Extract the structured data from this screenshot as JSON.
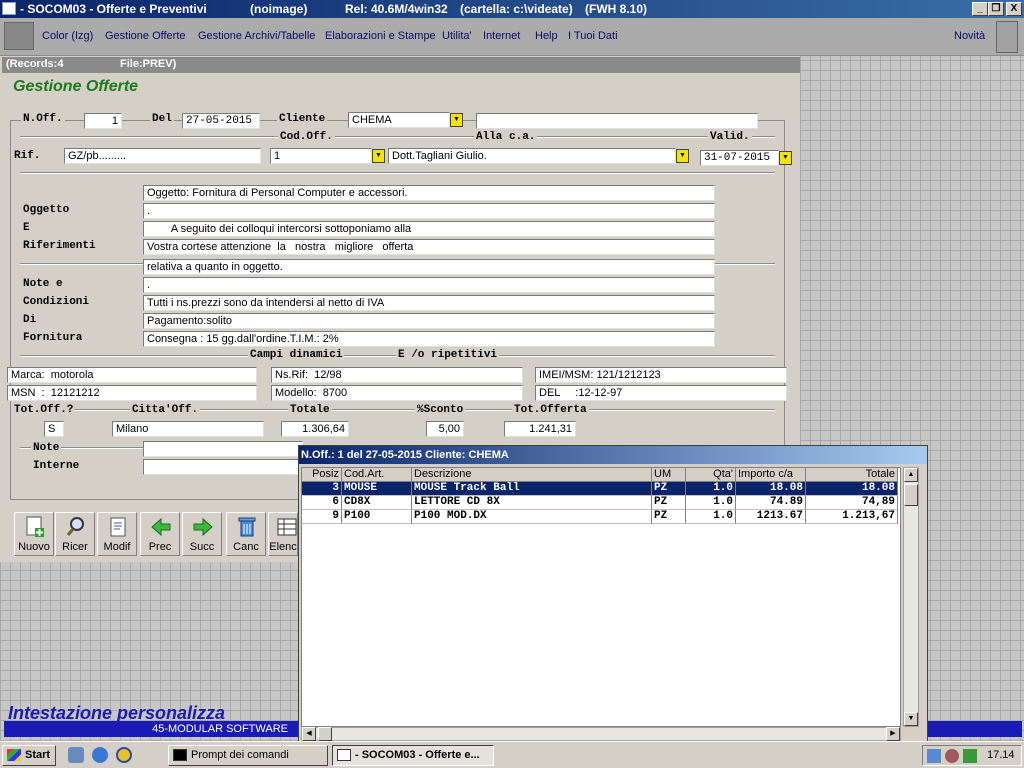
{
  "window": {
    "title": "- SOCOM03 - Offerte e Preventivi",
    "info1": "(noimage)",
    "info2": "Rel: 40.6M/4win32",
    "info3": "(cartella: c:\\videate)",
    "info4": "(FWH 8.10)",
    "btn_min": "_",
    "btn_restore": "❐",
    "btn_close": "X"
  },
  "menu": {
    "items": [
      "Color (Izg)",
      "Gestione Offerte",
      "Gestione Archivi/Tabelle",
      "Elaborazioni e Stampe",
      "Utilita'",
      "Internet",
      "Help",
      "I Tuoi Dati"
    ],
    "novita": "Novità"
  },
  "status": {
    "records": "(Records:4",
    "file": "File:PREV)"
  },
  "form": {
    "title": "Gestione Offerte",
    "labels": {
      "noff": "N.Off.",
      "del": "Del",
      "cliente": "Cliente",
      "codoff": "Cod.Off.",
      "alla": "Alla c.a.",
      "valid": "Valid.",
      "rif": "Rif.",
      "oggetto": "Oggetto",
      "e": "E",
      "riferimenti": "Riferimenti",
      "note_e": "Note e",
      "condizioni": "Condizioni",
      "di": "Di",
      "fornitura": "Fornitura",
      "campi": "Campi dinamici",
      "ripetitivi": "E /o ripetitivi",
      "totoff": "Tot.Off.?",
      "citta": "Citta'Off.",
      "totale": "Totale",
      "sconto": "%Sconto",
      "totofferta": "Tot.Offerta",
      "note": "Note",
      "interne": "Interne"
    },
    "values": {
      "noff": "1",
      "del": "27-05-2015",
      "cliente": "CHEMA",
      "cliente_desc": "",
      "rif": "GZ/pb.........",
      "codoff": "1",
      "alla": "Dott.Tagliani Giulio.",
      "valid": "31-07-2015",
      "testo": [
        "Oggetto: Fornitura di Personal Computer e accessori.",
        ".",
        "        A seguito dei colloqui intercorsi sottoponiamo alla",
        "Vostra cortese attenzione  la   nostra   migliore   offerta",
        "relativa a quanto in oggetto."
      ],
      "condizioni": [
        ".",
        "Tutti i ns.prezzi sono da intendersi al netto di IVA",
        "Pagamento:solito",
        "Consegna : 15 gg.dall'ordine.T.I.M.: 2%"
      ],
      "dinamici": [
        "Marca:  motorola",
        "Ns.Rif:  12/98",
        "IMEI/MSM: 121/1212123",
        "MSN  :  12121212",
        "Modello:  8700",
        "DEL     :12-12-97"
      ],
      "totoff": "S",
      "citta": "Milano",
      "totale": "1.306,64",
      "sconto": "5,00",
      "totofferta": "1.241,31"
    }
  },
  "toolbar": {
    "buttons": [
      {
        "label": "Nuovo",
        "icon": "new-document-icon"
      },
      {
        "label": "Ricer",
        "icon": "magnifier-icon"
      },
      {
        "label": "Modif",
        "icon": "edit-document-icon"
      },
      {
        "label": "Prec",
        "icon": "arrow-left-icon"
      },
      {
        "label": "Succ",
        "icon": "arrow-right-icon"
      },
      {
        "label": "Canc",
        "icon": "trash-icon"
      },
      {
        "label": "Elenc",
        "icon": "list-icon"
      }
    ]
  },
  "banner": {
    "title": "Intestazione personalizza",
    "subtitle": "45-MODULAR SOFTWARE"
  },
  "popup": {
    "title": "N.Off.:    1 del 27-05-2015 Cliente: CHEMA",
    "columns": [
      "Posiz",
      "Cod.Art.",
      "Descrizione",
      "UM",
      "Qta'",
      "Importo c/a",
      "Totale"
    ],
    "rows": [
      [
        "3",
        "MOUSE",
        "MOUSE Track Ball",
        "PZ",
        "1.0",
        "18.08",
        "18.08"
      ],
      [
        "6",
        "CD8X",
        "LETTORE CD 8X",
        "PZ",
        "1.0",
        "74.89",
        "74,89"
      ],
      [
        "9",
        "P100",
        "P100 MOD.DX",
        "PZ",
        "1.0",
        "1213.67",
        "1.213,67"
      ]
    ],
    "selected_row": 0
  },
  "taskbar": {
    "start": "Start",
    "tasks": [
      "Prompt dei comandi",
      "- SOCOM03 - Offerte e..."
    ],
    "clock": "17.14"
  }
}
